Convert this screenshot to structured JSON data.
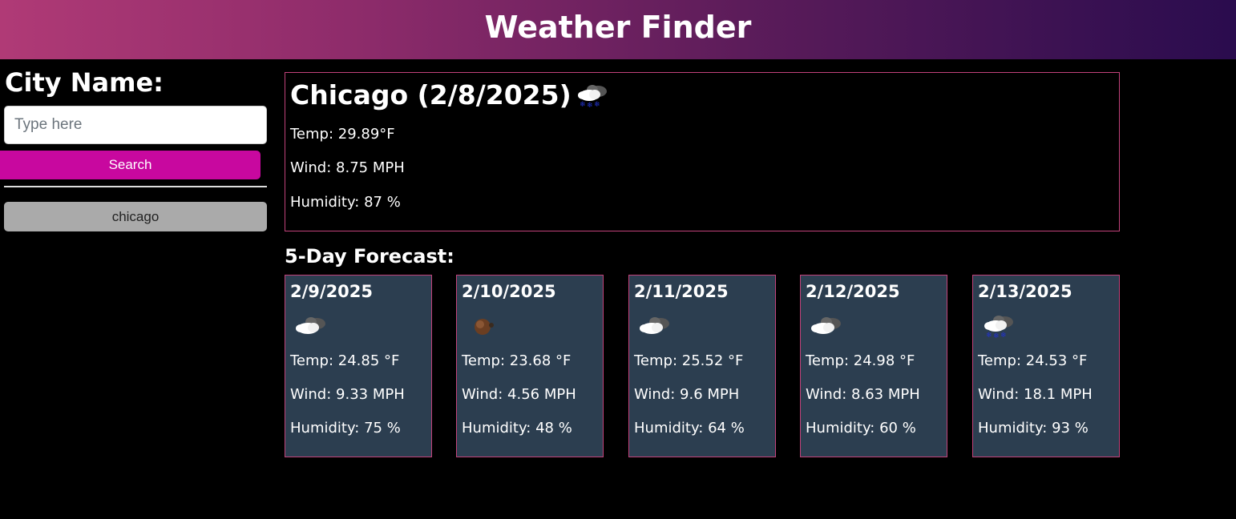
{
  "header": {
    "title": "Weather Finder"
  },
  "sidebar": {
    "label": "City Name:",
    "input_placeholder": "Type here",
    "input_value": "",
    "search_label": "Search",
    "history": [
      "chicago"
    ]
  },
  "current": {
    "title": "Chicago (2/8/2025)",
    "icon": "snow-cloud-icon",
    "temp": "Temp: 29.89°F",
    "wind": "Wind: 8.75 MPH",
    "humidity": "Humidity: 87 %"
  },
  "forecast": {
    "heading": "5-Day Forecast:",
    "days": [
      {
        "date": "2/9/2025",
        "icon": "broken-clouds-icon",
        "temp": "Temp: 24.85 °F",
        "wind": "Wind: 9.33 MPH",
        "humidity": "Humidity: 75 %"
      },
      {
        "date": "2/10/2025",
        "icon": "clear-night-icon",
        "temp": "Temp: 23.68 °F",
        "wind": "Wind: 4.56 MPH",
        "humidity": "Humidity: 48 %"
      },
      {
        "date": "2/11/2025",
        "icon": "broken-clouds-icon",
        "temp": "Temp: 25.52 °F",
        "wind": "Wind: 9.6 MPH",
        "humidity": "Humidity: 64 %"
      },
      {
        "date": "2/12/2025",
        "icon": "broken-clouds-icon",
        "temp": "Temp: 24.98 °F",
        "wind": "Wind: 8.63 MPH",
        "humidity": "Humidity: 60 %"
      },
      {
        "date": "2/13/2025",
        "icon": "snow-cloud-icon",
        "temp": "Temp: 24.53 °F",
        "wind": "Wind: 18.1 MPH",
        "humidity": "Humidity: 93 %"
      }
    ]
  },
  "colors": {
    "accent": "#c8089f",
    "card_bg": "#2c3e50",
    "card_border": "#c2427a",
    "history_btn": "#aaaaaa"
  }
}
